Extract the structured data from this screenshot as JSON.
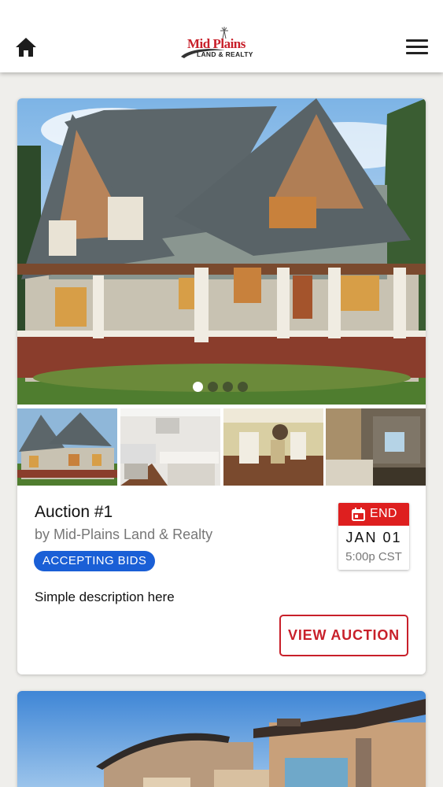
{
  "header": {
    "home_icon": "home-icon",
    "menu_icon": "hamburger-menu-icon",
    "logo_line1": "Mid Plains",
    "logo_line2": "LAND & REALTY",
    "brand_color": "#c8202a"
  },
  "listing": {
    "title": "Auction #1",
    "byline": "by Mid-Plains Land & Realty",
    "status": "ACCEPTING BIDS",
    "status_color": "#1a5fd6",
    "description": "Simple description here",
    "end_label": "END",
    "end_icon": "calendar-icon",
    "end_date": "JAN 01",
    "end_time": "5:00p CST",
    "end_color": "#de1f1f",
    "cta_label": "VIEW AUCTION",
    "carousel_total": 4,
    "carousel_active": 1,
    "thumbnails": [
      "house-exterior",
      "kitchen",
      "dining-room",
      "living-room"
    ]
  }
}
